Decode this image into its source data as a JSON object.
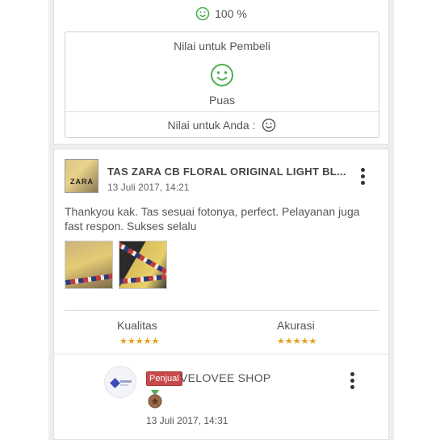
{
  "summary": {
    "percent": "100 %",
    "rating_box": {
      "buyer_label": "Nilai untuk Pembeli",
      "buyer_value": "Puas",
      "you_label": "Nilai untuk Anda :"
    }
  },
  "review": {
    "product_title": "TAS ZARA CB FLORAL ORIGINAL LIGHT BL...",
    "product_thumb_text": "ZARA",
    "date": "13 Juli 2017, 14:21",
    "text": "Thankyou kak. Tas sesuai fotonya, perfect. Pelayanan juga fast respon. Sukses selalu",
    "photo_count": 2,
    "scores": [
      {
        "label": "Kualitas",
        "stars": "★★★★★",
        "rating": 5
      },
      {
        "label": "Akurasi",
        "stars": "★★★★★",
        "rating": 5
      }
    ],
    "reply": {
      "badge": "Penjual",
      "seller_name": "VELOVEE SHOP",
      "date": "13 Juli 2017, 14:31"
    }
  },
  "colors": {
    "smile_green": "#4caf50",
    "star_orange": "#e7a21a",
    "badge_red": "#c74a4a"
  },
  "icons": [
    "smile-icon",
    "more-vert-icon",
    "medal-icon",
    "seller-logo"
  ]
}
